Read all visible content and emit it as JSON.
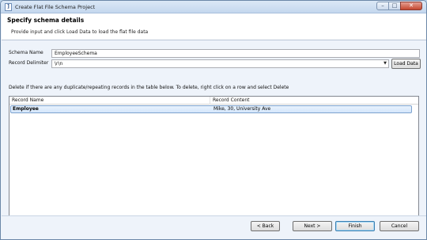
{
  "window": {
    "title": "Create Flat File Schema Project",
    "app_icon_glyph": "]"
  },
  "header": {
    "title": "Specify schema details",
    "description": "Provide input and click Load Data to load the flat file data"
  },
  "form": {
    "schema_name_label": "Schema Name",
    "schema_name_value": "EmployeeSchema",
    "record_delimiter_label": "Record Delimiter",
    "record_delimiter_value": "\\r\\n",
    "load_data_label": "Load Data"
  },
  "table": {
    "instruction": "Delete if there are any duplicate/repeating records in the table below. To delete, right click on a row and select Delete",
    "columns": [
      "Record Name",
      "Record Content"
    ],
    "rows": [
      {
        "name": "Employee",
        "content": "Mike, 30, University Ave"
      }
    ]
  },
  "footer": {
    "back_label": "Back",
    "next_label": "Next",
    "finish_label": "Finish",
    "cancel_label": "Cancel"
  },
  "icons": {
    "minimize": "minimize-icon",
    "maximize": "maximize-icon",
    "close": "close-icon",
    "dropdown": "chevron-down-icon"
  }
}
